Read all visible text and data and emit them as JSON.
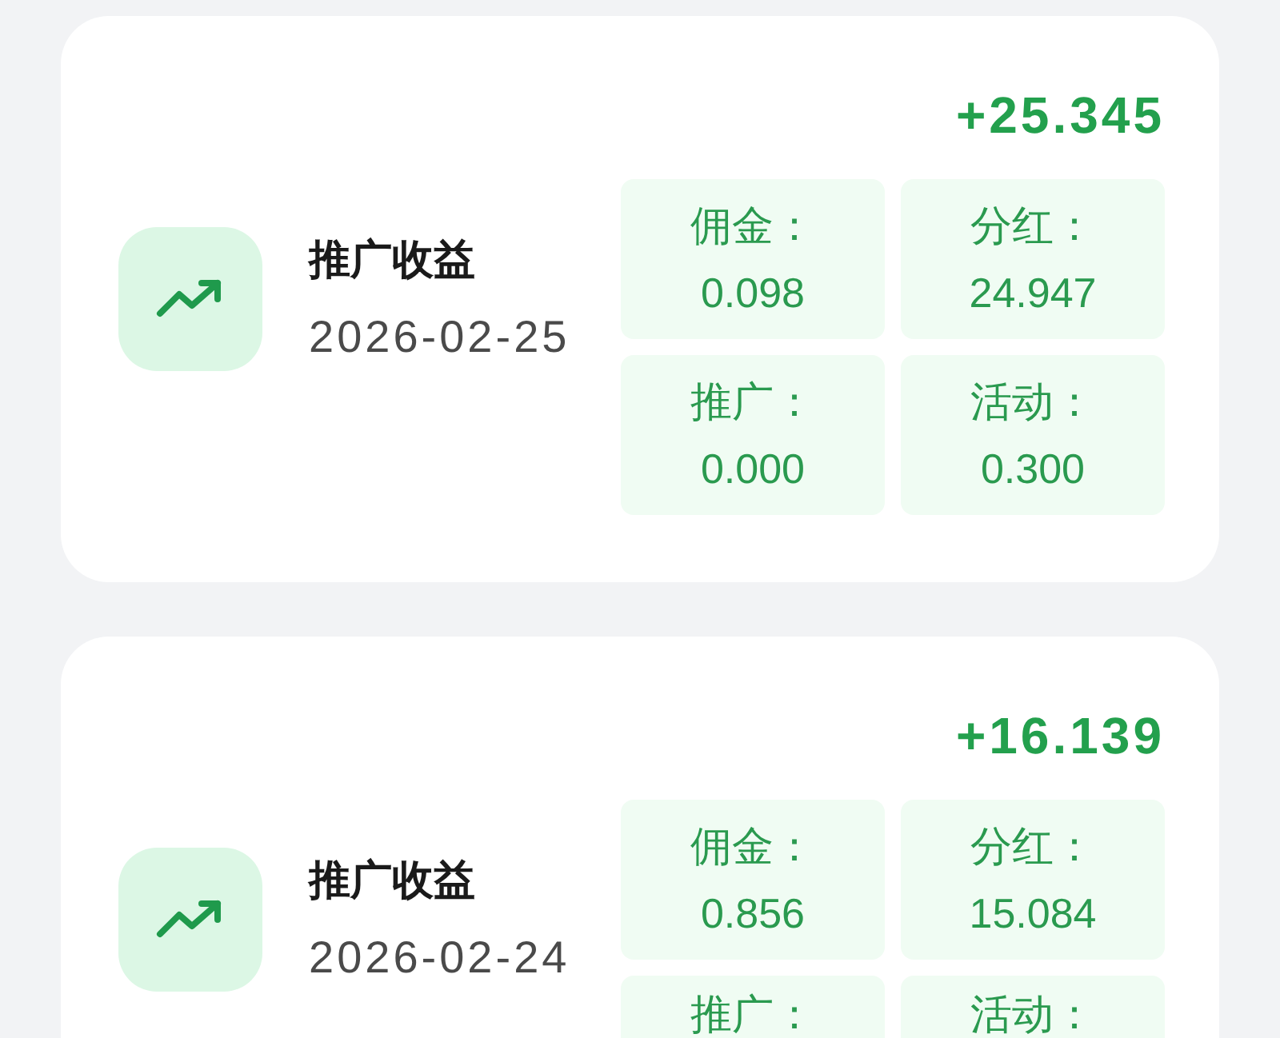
{
  "records": [
    {
      "title": "推广收益",
      "date": "2026-02-25",
      "amount": "+25.345",
      "breakdown": [
        {
          "label": "佣金：",
          "value": "0.098"
        },
        {
          "label": "分红：",
          "value": "24.947"
        },
        {
          "label": "推广：",
          "value": "0.000"
        },
        {
          "label": "活动：",
          "value": "0.300"
        }
      ]
    },
    {
      "title": "推广收益",
      "date": "2026-02-24",
      "amount": "+16.139",
      "breakdown": [
        {
          "label": "佣金：",
          "value": "0.856"
        },
        {
          "label": "分红：",
          "value": "15.084"
        },
        {
          "label": "推广："
        },
        {
          "label": "活动："
        }
      ]
    }
  ]
}
